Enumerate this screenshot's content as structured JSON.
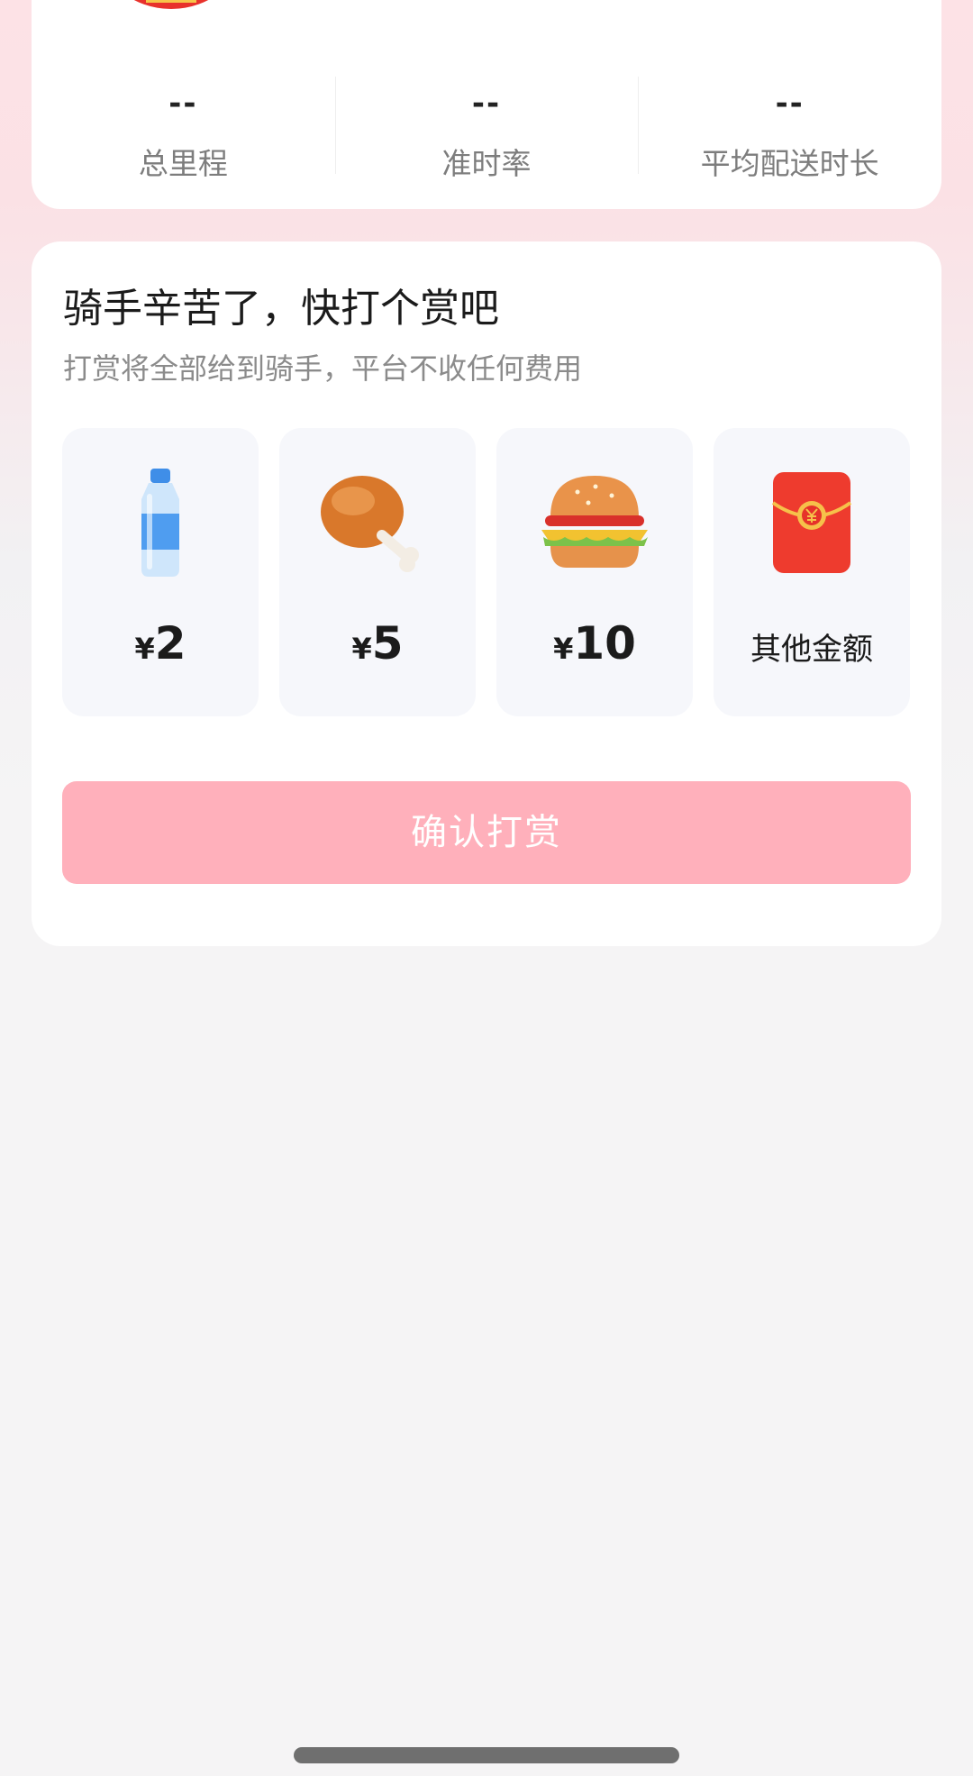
{
  "stats": [
    {
      "value": "--",
      "label": "总里程"
    },
    {
      "value": "--",
      "label": "准时率"
    },
    {
      "value": "--",
      "label": "平均配送时长"
    }
  ],
  "tip": {
    "title": "骑手辛苦了，快打个赏吧",
    "subtitle": "打赏将全部给到骑手，平台不收任何费用",
    "options": [
      {
        "icon": "water-bottle-icon",
        "currency": "¥",
        "amount": "2"
      },
      {
        "icon": "chicken-leg-icon",
        "currency": "¥",
        "amount": "5"
      },
      {
        "icon": "burger-icon",
        "currency": "¥",
        "amount": "10"
      },
      {
        "icon": "red-envelope-icon",
        "label": "其他金额"
      }
    ],
    "confirm_label": "确认打赏"
  },
  "colors": {
    "accent_disabled": "#ffb0bb",
    "card_bg": "#ffffff",
    "option_bg": "#f6f7fb"
  }
}
